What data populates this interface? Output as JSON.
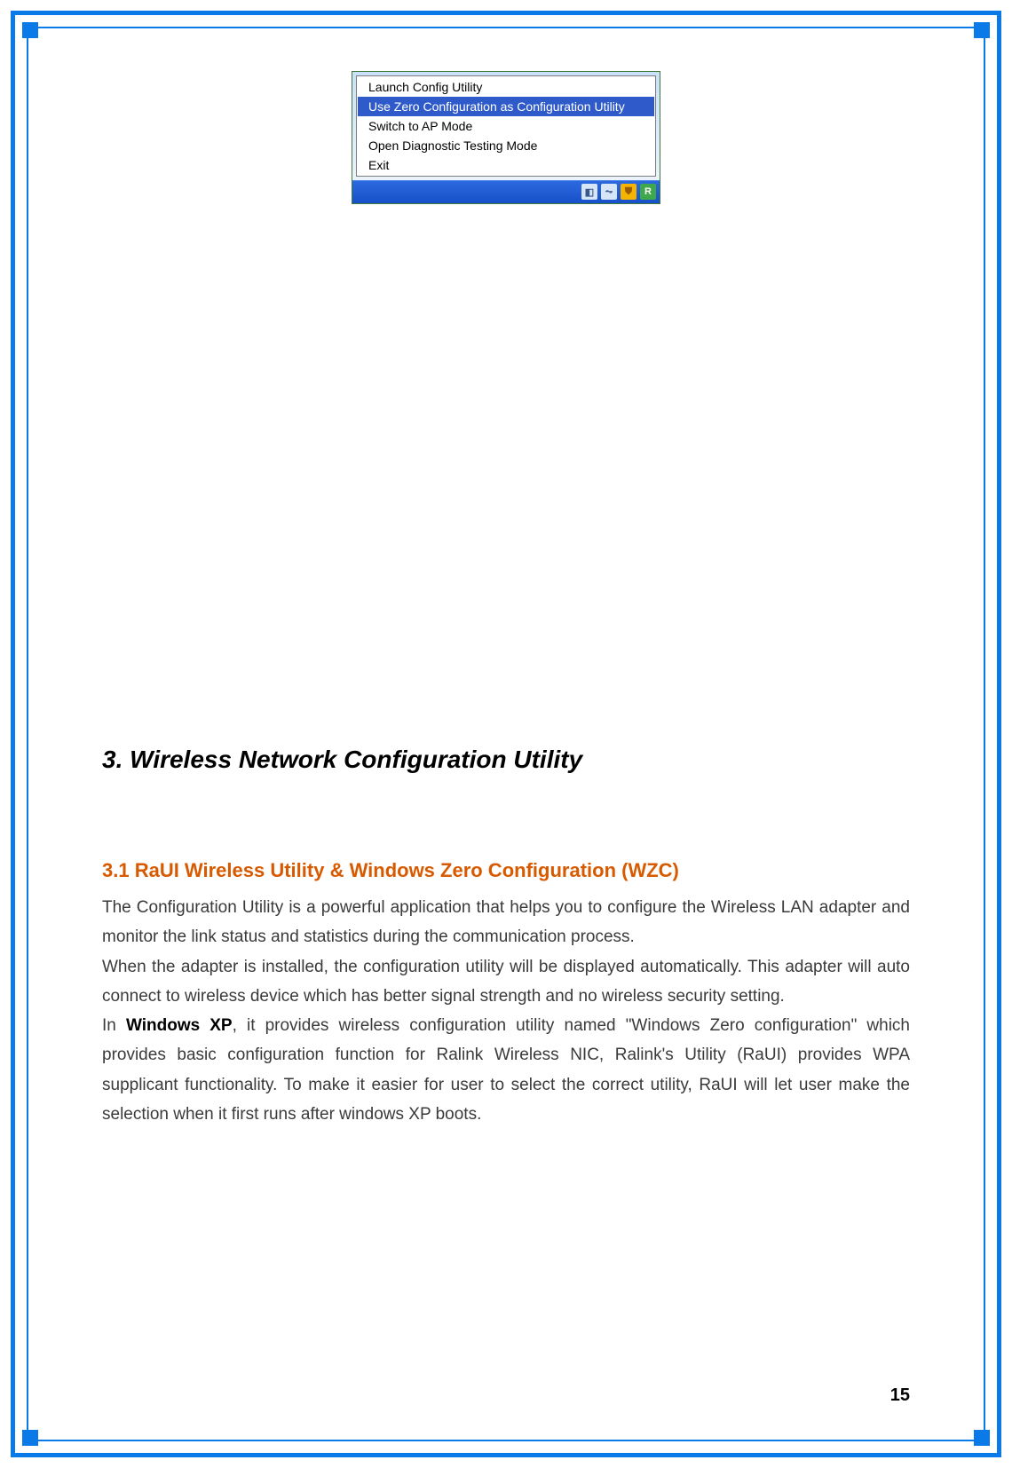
{
  "menu": {
    "items": [
      {
        "label": "Launch Config Utility",
        "selected": false
      },
      {
        "label": "Use Zero Configuration as Configuration Utility",
        "selected": true
      },
      {
        "label": "Switch to AP Mode",
        "selected": false
      },
      {
        "label": "Open Diagnostic Testing Mode",
        "selected": false
      },
      {
        "label": "Exit",
        "selected": false
      }
    ],
    "tray_icons": [
      "monitor-icon",
      "network-icon",
      "shield-icon",
      "ralink-icon"
    ]
  },
  "section": {
    "title": "3. Wireless Network Configuration Utility",
    "subtitle": "3.1 RaUI Wireless Utility & Windows Zero Configuration (WZC)",
    "para1": "The Configuration Utility is a powerful application that helps you to configure the Wireless LAN adapter and monitor the link status and statistics during the communication process.",
    "para2": "When the adapter is installed, the configuration utility will be displayed automatically. This adapter will auto connect to wireless device which has better signal strength and no wireless security setting.",
    "para3_pre": "In ",
    "para3_bold": "Windows XP",
    "para3_post": ", it provides wireless configuration utility named \"Windows Zero configuration\" which provides basic configuration function for Ralink Wireless NIC, Ralink's Utility (RaUI) provides WPA supplicant functionality. To make it easier for user to select the correct utility, RaUI will let user make the selection when it first runs after windows XP boots."
  },
  "page_number": "15"
}
